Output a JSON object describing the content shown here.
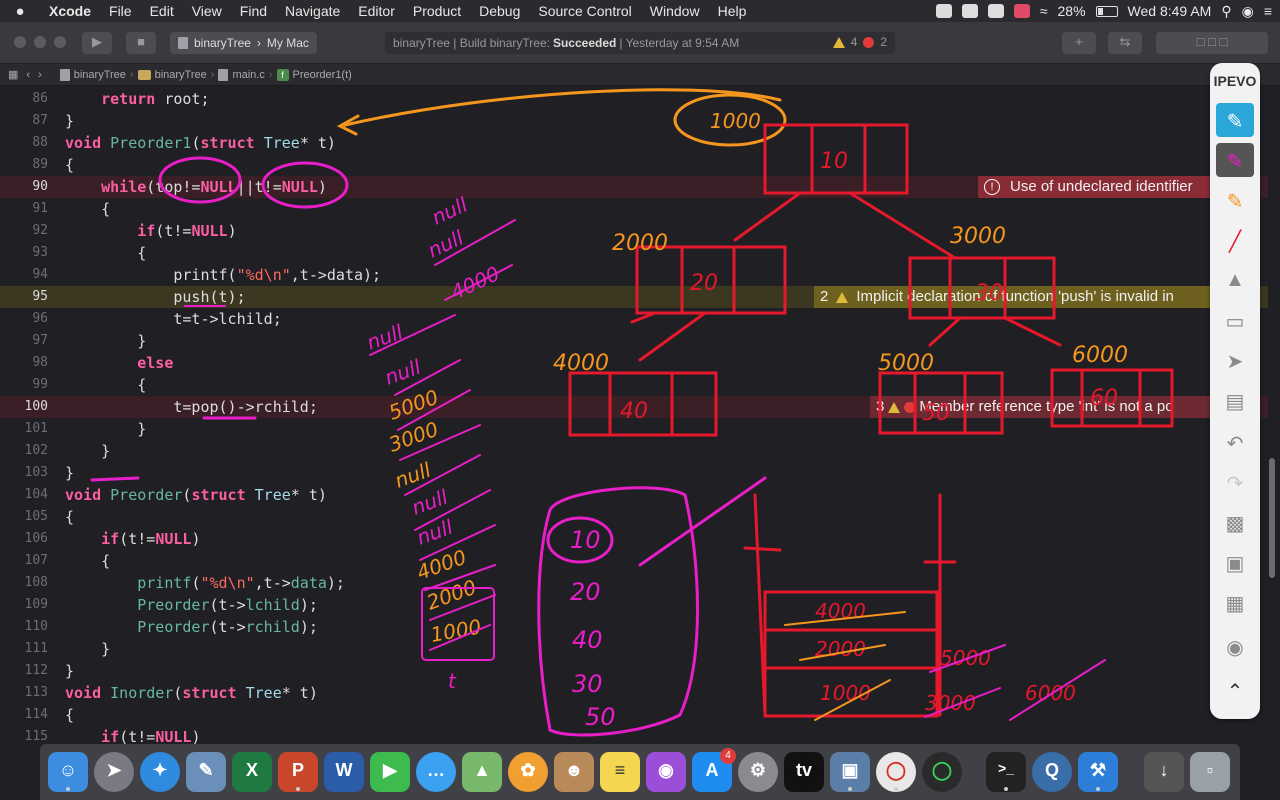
{
  "menubar": {
    "apple": "",
    "app_name": "Xcode",
    "menus": [
      "File",
      "Edit",
      "View",
      "Find",
      "Navigate",
      "Editor",
      "Product",
      "Debug",
      "Source Control",
      "Window",
      "Help"
    ],
    "battery": "28%",
    "clock": "Wed 8:49 AM"
  },
  "toolbar": {
    "scheme": "binaryTree",
    "destination": "My Mac",
    "status_prefix": "binaryTree | Build binaryTree:",
    "status_result": "Succeeded",
    "status_time": "| Yesterday at 9:54 AM",
    "warning_count": "4",
    "error_count": "2"
  },
  "jumpbar": {
    "crumbs": [
      "binaryTree",
      "binaryTree",
      "main.c",
      "Preorder1(t)"
    ]
  },
  "issues": {
    "line90": "Use of undeclared identifier",
    "line95_count": "2",
    "line95": "Implicit declaration of function 'push' is invalid in",
    "line100_count": "3",
    "line100": "Member reference type 'int' is not a po"
  },
  "code": {
    "lines": [
      {
        "n": "86",
        "t": "    return root;"
      },
      {
        "n": "87",
        "t": "}"
      },
      {
        "n": "88",
        "t": "void Preorder1(struct Tree* t)"
      },
      {
        "n": "89",
        "t": "{"
      },
      {
        "n": "90",
        "t": "    while(top!=NULL||t!=NULL)"
      },
      {
        "n": "91",
        "t": "    {"
      },
      {
        "n": "92",
        "t": "        if(t!=NULL)"
      },
      {
        "n": "93",
        "t": "        {"
      },
      {
        "n": "94",
        "t": "            printf(\"%d\\n\",t->data);"
      },
      {
        "n": "95",
        "t": "            push(t);"
      },
      {
        "n": "96",
        "t": "            t=t->lchild;"
      },
      {
        "n": "97",
        "t": "        }"
      },
      {
        "n": "98",
        "t": "        else"
      },
      {
        "n": "99",
        "t": "        {"
      },
      {
        "n": "100",
        "t": "            t=pop()->rchild;"
      },
      {
        "n": "101",
        "t": "        }"
      },
      {
        "n": "102",
        "t": "    }"
      },
      {
        "n": "103",
        "t": "}"
      },
      {
        "n": "104",
        "t": "void Preorder(struct Tree* t)"
      },
      {
        "n": "105",
        "t": "{"
      },
      {
        "n": "106",
        "t": "    if(t!=NULL)"
      },
      {
        "n": "107",
        "t": "    {"
      },
      {
        "n": "108",
        "t": "        printf(\"%d\\n\",t->data);"
      },
      {
        "n": "109",
        "t": "        Preorder(t->lchild);"
      },
      {
        "n": "110",
        "t": "        Preorder(t->rchild);"
      },
      {
        "n": "111",
        "t": "    }"
      },
      {
        "n": "112",
        "t": "}"
      },
      {
        "n": "113",
        "t": "void Inorder(struct Tree* t)"
      },
      {
        "n": "114",
        "t": "{"
      },
      {
        "n": "115",
        "t": "    if(t!=NULL)"
      }
    ]
  },
  "annotation": {
    "root_addr": "1000",
    "node_root": "10",
    "addr_left": "2000",
    "addr_right": "3000",
    "node_left": "20",
    "node_right": "30",
    "addr_ll": "4000",
    "addr_rl": "5000",
    "addr_rr": "6000",
    "node_ll": "40",
    "node_rl": "50",
    "node_rr": "60",
    "output": [
      "10",
      "20",
      "40",
      "30",
      "50"
    ],
    "stack_items": [
      "4000",
      "2000",
      "1000"
    ],
    "stack_side": [
      "5000",
      "3000",
      "6000"
    ],
    "trace": [
      "null",
      "null",
      "4000",
      "null",
      "null",
      "5000",
      "3000",
      "null",
      "null",
      "null",
      "4000",
      "2000",
      "1000",
      "t"
    ]
  },
  "ipevo": {
    "logo": "IPEVO",
    "tools": [
      "hand-pen-icon",
      "marker-icon",
      "highlighter-icon",
      "pen-icon",
      "stamp-icon",
      "eraser-icon",
      "pointer-icon",
      "toolbox-icon",
      "undo-icon",
      "redo-icon",
      "trash-icon",
      "capture-icon",
      "region-icon",
      "camera-icon",
      "collapse-icon"
    ]
  },
  "dock": {
    "apps": [
      "Finder",
      "Launchpad",
      "Safari",
      "Preview",
      "Excel",
      "PowerPoint",
      "Word",
      "FaceTime",
      "Messages",
      "Maps",
      "Photos",
      "Contacts",
      "Notes",
      "Podcasts",
      "App Store",
      "System Preferences",
      "TV",
      "Image Capture",
      "Chrome",
      "Activity",
      "Terminal",
      "QuickTime",
      "Xcode",
      "Downloads",
      "Trash"
    ],
    "appstore_badge": "4"
  },
  "colors": {
    "ink_red": "#e5182c",
    "ink_orange": "#f5961e",
    "ink_magenta": "#e81ec8",
    "error_bg": "#8a2c36",
    "warning_bg": "#6e611f"
  }
}
